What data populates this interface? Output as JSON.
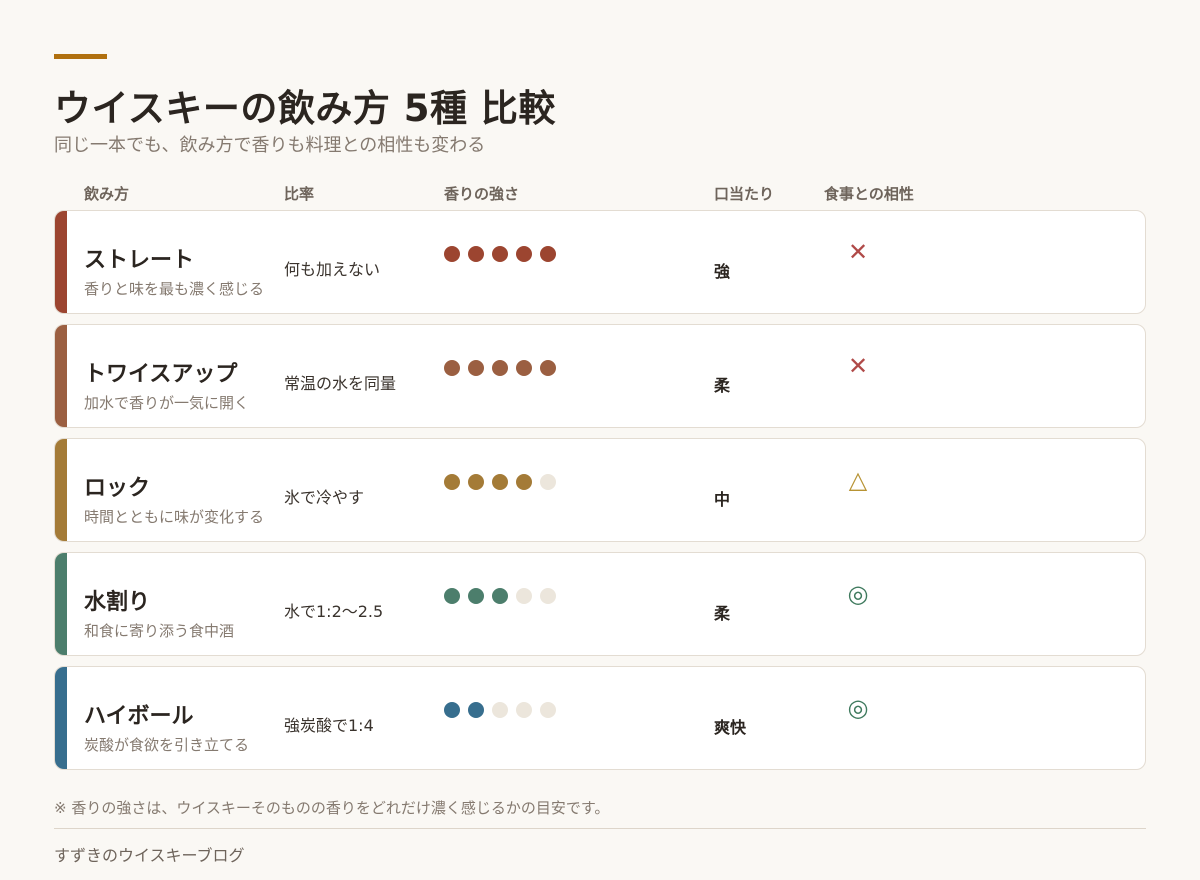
{
  "title": "ウイスキーの飲み方 5種 比較",
  "subtitle": "同じ一本でも、飲み方で香りも料理との相性も変わる",
  "headers": {
    "method": "飲み方",
    "ratio": "比率",
    "aroma": "香りの強さ",
    "mouthfeel": "口当たり",
    "pairing": "食事との相性"
  },
  "rows": [
    {
      "name": "ストレート",
      "desc": "香りと味を最も濃く感じる",
      "ratio": "何も加えない",
      "aroma_level": 5,
      "aroma_max": 5,
      "mouthfeel": "強",
      "pairing": "✕",
      "color": "#9c4530",
      "pairing_color": "#b04a48"
    },
    {
      "name": "トワイスアップ",
      "desc": "加水で香りが一気に開く",
      "ratio": "常温の水を同量",
      "aroma_level": 5,
      "aroma_max": 5,
      "mouthfeel": "柔",
      "pairing": "✕",
      "color": "#9b5f41",
      "pairing_color": "#b04a48"
    },
    {
      "name": "ロック",
      "desc": "時間とともに味が変化する",
      "ratio": "氷で冷やす",
      "aroma_level": 4,
      "aroma_max": 5,
      "mouthfeel": "中",
      "pairing": "△",
      "color": "#a47b37",
      "pairing_color": "#b79334"
    },
    {
      "name": "水割り",
      "desc": "和食に寄り添う食中酒",
      "ratio": "水で1:2〜2.5",
      "aroma_level": 3,
      "aroma_max": 5,
      "mouthfeel": "柔",
      "pairing": "◎",
      "color": "#4c7e6c",
      "pairing_color": "#3f7a5e"
    },
    {
      "name": "ハイボール",
      "desc": "炭酸が食欲を引き立てる",
      "ratio": "強炭酸で1:4",
      "aroma_level": 2,
      "aroma_max": 5,
      "mouthfeel": "爽快",
      "pairing": "◎",
      "color": "#376e8e",
      "pairing_color": "#3f7a5e"
    }
  ],
  "footnote": "※ 香りの強さは、ウイスキーそのものの香りをどれだけ濃く感じるかの目安です。",
  "footer": "すずきのウイスキーブログ",
  "colors": {
    "accent": "#b0700f",
    "dot_empty": "#ece6dc"
  }
}
